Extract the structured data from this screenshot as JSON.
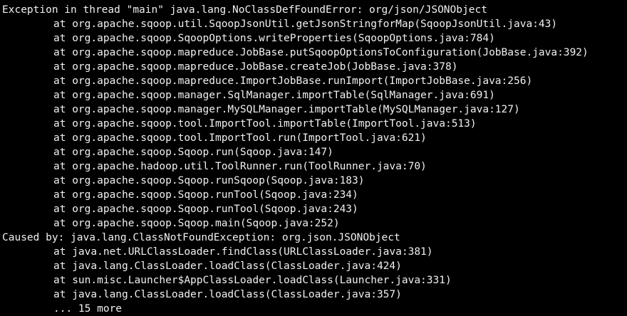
{
  "terminal": {
    "lines": [
      "Exception in thread \"main\" java.lang.NoClassDefFoundError: org/json/JSONObject",
      "at org.apache.sqoop.util.SqoopJsonUtil.getJsonStringforMap(SqoopJsonUtil.java:43)",
      "at org.apache.sqoop.SqoopOptions.writeProperties(SqoopOptions.java:784)",
      "at org.apache.sqoop.mapreduce.JobBase.putSqoopOptionsToConfiguration(JobBase.java:392)",
      "at org.apache.sqoop.mapreduce.JobBase.createJob(JobBase.java:378)",
      "at org.apache.sqoop.mapreduce.ImportJobBase.runImport(ImportJobBase.java:256)",
      "at org.apache.sqoop.manager.SqlManager.importTable(SqlManager.java:691)",
      "at org.apache.sqoop.manager.MySQLManager.importTable(MySQLManager.java:127)",
      "at org.apache.sqoop.tool.ImportTool.importTable(ImportTool.java:513)",
      "at org.apache.sqoop.tool.ImportTool.run(ImportTool.java:621)",
      "at org.apache.sqoop.Sqoop.run(Sqoop.java:147)",
      "at org.apache.hadoop.util.ToolRunner.run(ToolRunner.java:70)",
      "at org.apache.sqoop.Sqoop.runSqoop(Sqoop.java:183)",
      "at org.apache.sqoop.Sqoop.runTool(Sqoop.java:234)",
      "at org.apache.sqoop.Sqoop.runTool(Sqoop.java:243)",
      "at org.apache.sqoop.Sqoop.main(Sqoop.java:252)",
      "Caused by: java.lang.ClassNotFoundException: org.json.JSONObject",
      "at java.net.URLClassLoader.findClass(URLClassLoader.java:381)",
      "at java.lang.ClassLoader.loadClass(ClassLoader.java:424)",
      "at sun.misc.Launcher$AppClassLoader.loadClass(Launcher.java:331)",
      "at java.lang.ClassLoader.loadClass(ClassLoader.java:357)",
      "... 15 more"
    ]
  }
}
